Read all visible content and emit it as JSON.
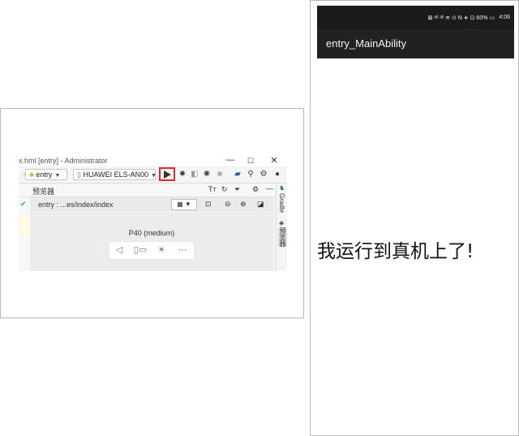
{
  "ide": {
    "window_title": "x.hml [entry] - Administrator",
    "minimize_glyph": "—",
    "maximize_glyph": "☐",
    "close_glyph": "✕",
    "module_select": "entry",
    "device_select": "HUAWEI ELS-AN00",
    "previewer_label": "预览器",
    "preview_path": "entry : ...es/index/index",
    "device_name": "P40 (medium)",
    "gradle_tab": "Gradle",
    "previewer_tab": "预览器"
  },
  "phone": {
    "status_icons": "⊠ ᵃᵗˡ ᵃˡˡ ≋ ⊙  N ∗ ⊡ 60% ▭",
    "time": "4:06",
    "app_title": "entry_MainAbility",
    "content_text": "我运行到真机上了!"
  },
  "colors": {
    "run_highlight": "#e0282e",
    "appbar_bg": "#212121",
    "statusbar_bg": "#1b1b1b"
  }
}
